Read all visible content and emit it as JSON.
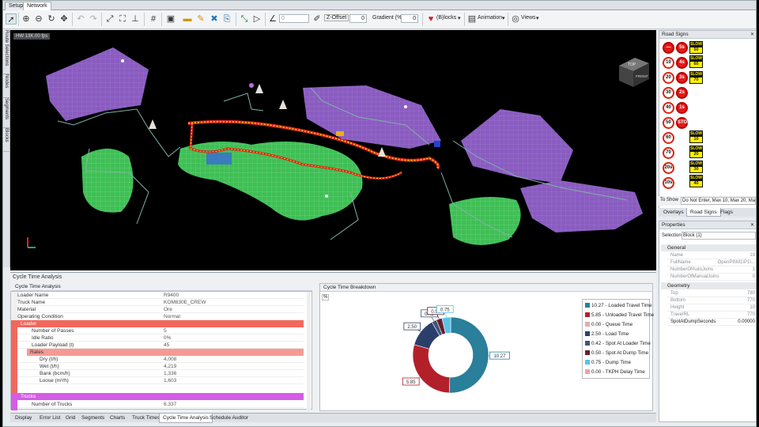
{
  "top_tabs": [
    "Setup",
    "Network"
  ],
  "toolbar": {
    "z_offset_label": "Z-Offset",
    "z_offset_value": "0",
    "gradient_label": "Gradient (%)",
    "gradient_value": "0",
    "blocks_label": "(B)locks",
    "animation_label": "Animation",
    "views_label": "Views"
  },
  "left_tabs": [
    "Route Selections",
    "Nodes",
    "Segments",
    "Blocks"
  ],
  "viewport": {
    "hw_badge": "HW 13K.00 fps",
    "cube_labels": [
      "TOP",
      "FRONT"
    ]
  },
  "cycle_time_panel": {
    "title": "Cycle Time Analysis",
    "left_title": "Cycle Time Analysis",
    "rows_top": [
      {
        "k": "Loader Name",
        "v": "R9400"
      },
      {
        "k": "Truck Name",
        "v": "KOM830E_CREW"
      },
      {
        "k": "Material",
        "v": "Ore"
      },
      {
        "k": "Operating Condition",
        "v": "Normal"
      }
    ],
    "loader_group": "Loader",
    "loader_rows": [
      {
        "k": "Number of Passes",
        "v": "5"
      },
      {
        "k": "Idle Ratio",
        "v": "0%"
      },
      {
        "k": "Loader Payload (t)",
        "v": "45"
      }
    ],
    "rates_group": "Rates",
    "rates_rows": [
      {
        "k": "Dry (t/h)",
        "v": "4,008"
      },
      {
        "k": "Wet (t/h)",
        "v": "4,219"
      },
      {
        "k": "Bank (bcm/h)",
        "v": "1,336"
      },
      {
        "k": "Loose (m³/h)",
        "v": "1,603"
      }
    ],
    "trucks_group": "Trucks",
    "trucks_rows": [
      {
        "k": "Number of Trucks",
        "v": "6.337"
      }
    ],
    "right_title": "Cycle Time Breakdown",
    "percent_toggle": "%"
  },
  "chart_data": {
    "type": "pie",
    "title": "Cycle Time Breakdown",
    "donut": true,
    "series": [
      {
        "name": "Loaded Travel Time",
        "value": 10.27,
        "color": "#2a7f9a"
      },
      {
        "name": "Unloaded Travel Time",
        "value": 5.85,
        "color": "#b3202a"
      },
      {
        "name": "Queue Time",
        "value": 0.0,
        "color": "#e8a9ad"
      },
      {
        "name": "Load Time",
        "value": 2.5,
        "color": "#2b3f6b"
      },
      {
        "name": "Spot At Loader Time",
        "value": 0.42,
        "color": "#3f557d"
      },
      {
        "name": "Spot At Dump Time",
        "value": 0.5,
        "color": "#6a1e2c"
      },
      {
        "name": "Dump Time",
        "value": 0.75,
        "color": "#5bc2e7"
      },
      {
        "name": "TKPH Delay Time",
        "value": 0.0,
        "color": "#e7a5ad"
      }
    ],
    "legend_labels": [
      "10.27 - Loaded Travel Time",
      "5.85 - Unloaded Travel Time",
      "0.00 - Queue Time",
      "2.50 - Load Time",
      "0.42 - Spot At Loader Time",
      "0.50 - Spot At Dump Time",
      "0.75 - Dump Time",
      "0.00 - TKPH Delay Time"
    ],
    "data_labels": [
      "10.27",
      "5.85",
      "2.50",
      "0.42",
      "0.50",
      "0.75"
    ],
    "legend_position": "right"
  },
  "bottom_tabs": [
    "Display",
    "Error List",
    "Grid",
    "Segments",
    "Charts",
    "Truck Times",
    "Cycle Time Analysis",
    "Schedule Auditor"
  ],
  "road_signs": {
    "title": "Road Signs",
    "circle_signs": [
      "",
      "10",
      "20",
      "30",
      "40",
      "50",
      "60",
      "70",
      "20s",
      "10s"
    ],
    "red_signs": [
      "5s",
      "4s",
      "3s",
      "2s",
      "1s",
      "STOP"
    ],
    "slow_values": [
      "50",
      "60",
      "70",
      "10",
      "20",
      "30",
      "40"
    ],
    "slow_word": "SLOW",
    "to_show_label": "To Show",
    "to_show_value": "Do Not Enter, Max 10, Max 20, Ma...",
    "tabs": [
      "Overlays",
      "Road Signs",
      "Flags"
    ]
  },
  "properties": {
    "title": "Properties",
    "selection_label": "Selection:",
    "selection_value": "Block (1)",
    "general_group": "General",
    "general_rows": [
      {
        "k": "Name",
        "v": "19"
      },
      {
        "k": "FullName",
        "v": "OpenPit\\M1\\P1\\..."
      },
      {
        "k": "NumberOfAutoJoins",
        "v": "1"
      },
      {
        "k": "NumberOfManualJoins",
        "v": "0"
      }
    ],
    "geometry_group": "Geometry",
    "geometry_rows": [
      {
        "k": "Top",
        "v": "780"
      },
      {
        "k": "Bottom",
        "v": "770"
      },
      {
        "k": "Height",
        "v": "10"
      },
      {
        "k": "TravelRL",
        "v": "770"
      },
      {
        "k": "SpotAtDumpSeconds",
        "v": "0.00000"
      }
    ]
  }
}
